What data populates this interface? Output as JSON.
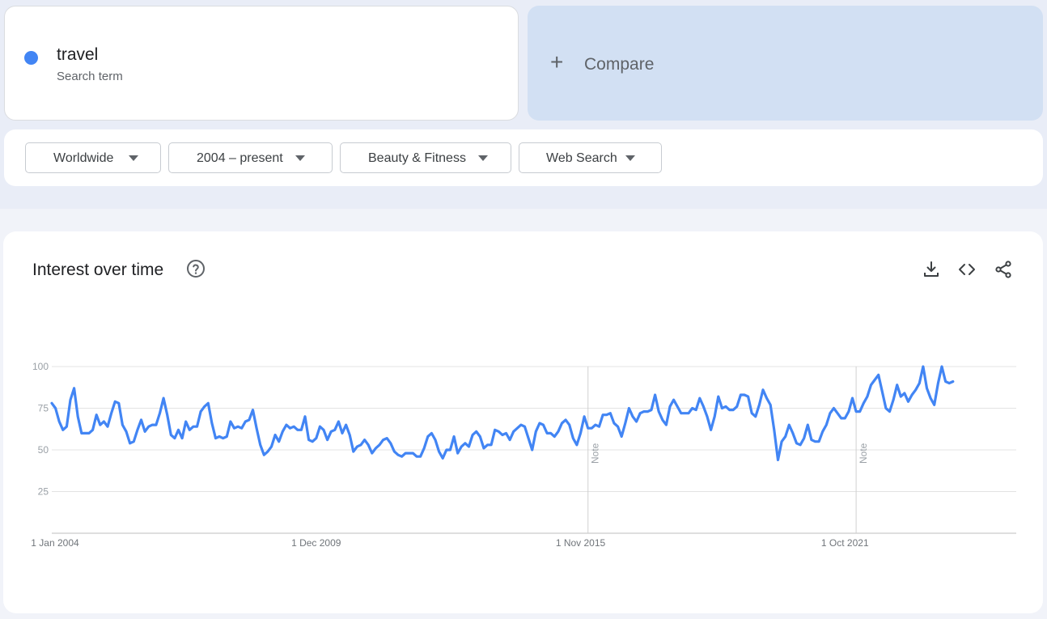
{
  "search_term": {
    "name": "travel",
    "subtitle": "Search term",
    "color": "#4285f4"
  },
  "compare": {
    "plus": "+",
    "label": "Compare"
  },
  "filters": [
    {
      "label": "Worldwide"
    },
    {
      "label": "2004 – present"
    },
    {
      "label": "Beauty & Fitness"
    },
    {
      "label": "Web Search"
    }
  ],
  "chart_panel": {
    "title": "Interest over time",
    "icons": [
      "help-icon",
      "download-icon",
      "embed-icon",
      "share-icon"
    ]
  },
  "chart_data": {
    "type": "line",
    "title": "Interest over time",
    "xlabel": "",
    "ylabel": "",
    "ylim": [
      0,
      100
    ],
    "yticks": [
      "100",
      "75",
      "50",
      "25"
    ],
    "x_tick_labels": [
      "1 Jan 2004",
      "1 Dec 2009",
      "1 Nov 2015",
      "1 Oct 2021"
    ],
    "x_range": [
      "2004-01",
      "2025-08"
    ],
    "annotations": [
      {
        "label": "Note",
        "x": "2016-01"
      },
      {
        "label": "Note",
        "x": "2022-01"
      }
    ],
    "grid": true,
    "series_color": "#4285f4",
    "series": [
      {
        "x_start": "2004-01",
        "interval": "month",
        "values": [
          78,
          75,
          67,
          62,
          64,
          80,
          87,
          70,
          60,
          60,
          60,
          62,
          71,
          65,
          67,
          64,
          72,
          79,
          78,
          65,
          61,
          54,
          55,
          62,
          68,
          61,
          64,
          65,
          65,
          72,
          81,
          71,
          59,
          57,
          62,
          57,
          67,
          62,
          64,
          64,
          73,
          76,
          78,
          66,
          57,
          58,
          57,
          58,
          67,
          63,
          64,
          63,
          67,
          68,
          74,
          63,
          53,
          47,
          49,
          52,
          59,
          55,
          61,
          65,
          63,
          64,
          62,
          62,
          70,
          56,
          55,
          57,
          64,
          62,
          56,
          61,
          62,
          67,
          60,
          65,
          59,
          49,
          52,
          53,
          56,
          53,
          48,
          51,
          53,
          56,
          57,
          54,
          49,
          47,
          46,
          48,
          48,
          48,
          46,
          46,
          51,
          58,
          60,
          56,
          49,
          45,
          50,
          50,
          58,
          48,
          52,
          54,
          52,
          59,
          61,
          58,
          51,
          53,
          53,
          62,
          61,
          59,
          60,
          56,
          61,
          63,
          65,
          64,
          57,
          50,
          61,
          66,
          65,
          60,
          60,
          58,
          61,
          66,
          68,
          65,
          57,
          53,
          60,
          70,
          63,
          63,
          65,
          64,
          71,
          71,
          72,
          66,
          64,
          58,
          66,
          75,
          70,
          67,
          72,
          73,
          73,
          74,
          83,
          73,
          68,
          65,
          76,
          80,
          76,
          72,
          72,
          72,
          75,
          74,
          81,
          76,
          70,
          62,
          70,
          82,
          75,
          76,
          74,
          74,
          76,
          83,
          83,
          82,
          72,
          70,
          77,
          86,
          81,
          77,
          62,
          44,
          55,
          58,
          65,
          60,
          54,
          53,
          57,
          65,
          56,
          55,
          55,
          61,
          65,
          72,
          75,
          72,
          69,
          69,
          73,
          81,
          73,
          73,
          78,
          82,
          89,
          92,
          95,
          85,
          75,
          73,
          80,
          89,
          82,
          84,
          79,
          83,
          86,
          90,
          100,
          87,
          81,
          77,
          90,
          100,
          91,
          90,
          91
        ]
      }
    ]
  }
}
